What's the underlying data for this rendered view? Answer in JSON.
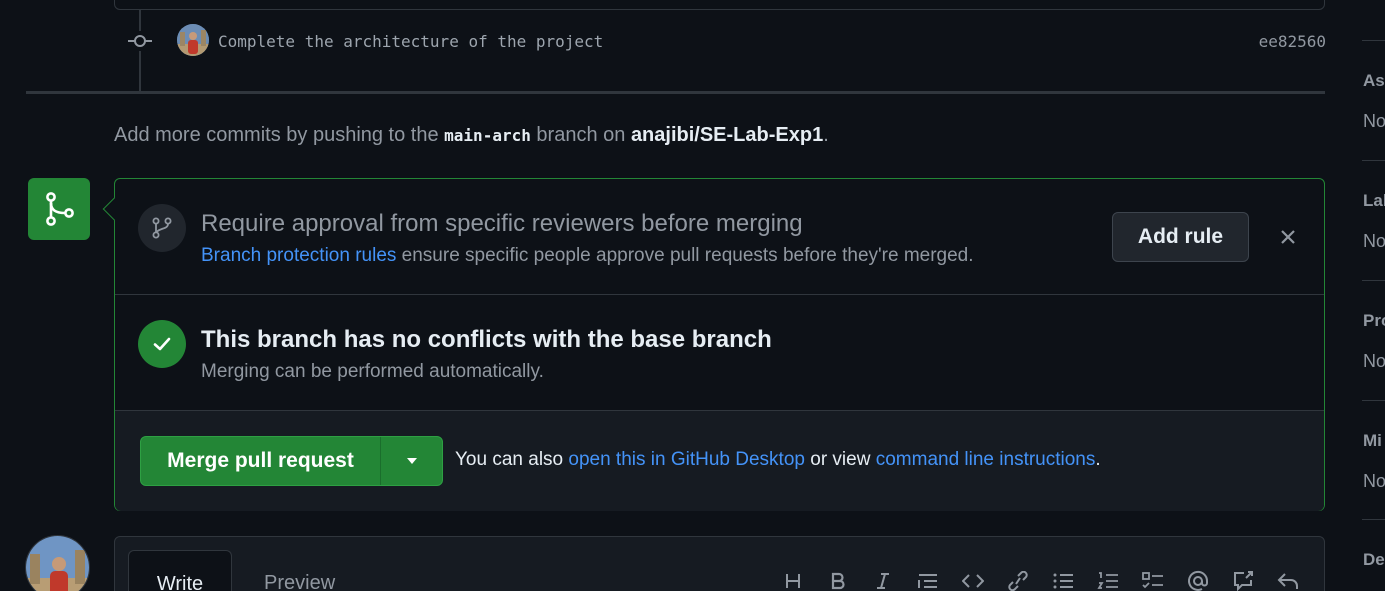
{
  "commit": {
    "message": "Complete the architecture of the project",
    "sha": "ee82560"
  },
  "push_note": {
    "prefix": "Add more commits by pushing to the ",
    "branch": "main-arch",
    "middle": " branch on ",
    "repo": "anajibi/SE-Lab-Exp1",
    "suffix": "."
  },
  "approval": {
    "title": "Require approval from specific reviewers before merging",
    "link": "Branch protection rules",
    "text": " ensure specific people approve pull requests before they're merged.",
    "button": "Add rule"
  },
  "conflicts": {
    "title": "This branch has no conflicts with the base branch",
    "subtitle": "Merging can be performed automatically."
  },
  "merge": {
    "button": "Merge pull request",
    "also_prefix": "You can also ",
    "desktop_link": "open this in GitHub Desktop",
    "or_view": " or view ",
    "cli_link": "command line instructions",
    "suffix": "."
  },
  "comment": {
    "tab_write": "Write",
    "tab_preview": "Preview",
    "toolbar": [
      "heading-icon",
      "bold-icon",
      "italic-icon",
      "quote-icon",
      "code-icon",
      "link-icon",
      "unordered-list-icon",
      "ordered-list-icon",
      "task-list-icon",
      "mention-icon",
      "cross-reference-icon",
      "reply-icon"
    ]
  },
  "sidebar": {
    "items": [
      {
        "head": "Ass",
        "value": "No"
      },
      {
        "head": "Lab",
        "value": "No"
      },
      {
        "head": "Pro",
        "value": "No"
      },
      {
        "head": "Mi",
        "value": "No"
      },
      {
        "head": "De",
        "value": ""
      }
    ]
  },
  "colors": {
    "background": "#0d1117",
    "success": "#238636",
    "link": "#4493f8",
    "muted": "#9198a1",
    "border": "#30363d"
  }
}
